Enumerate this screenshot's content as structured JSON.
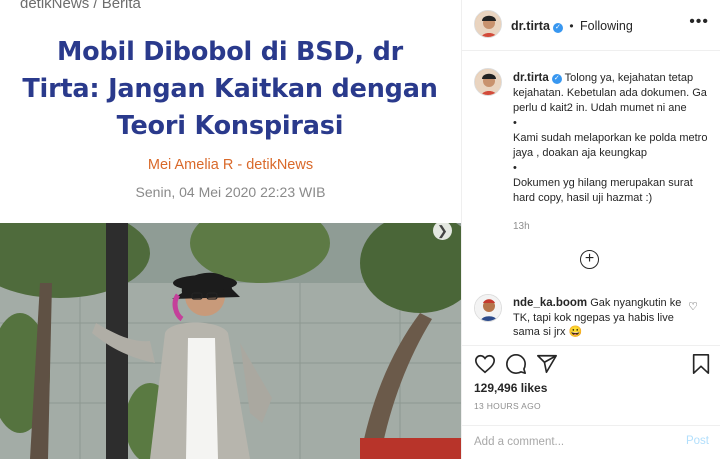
{
  "article": {
    "breadcrumb": "detikNews / Berita",
    "title": "Mobil Dibobol di BSD, dr Tirta: Jangan Kaitkan dengan Teori Konspirasi",
    "byline": "Mei Amelia R - detikNews",
    "date": "Senin, 04 Mei 2020 22:23 WIB"
  },
  "post": {
    "username": "dr.tirta",
    "follow_status": "Following",
    "more_label": "•••"
  },
  "caption": {
    "username": "dr.tirta",
    "lines": [
      "Tolong ya, kejahatan tetap kejahatan. Kebetulan ada dokumen. Ga perlu d kait2 in. Udah mumet ni ane",
      "•",
      "Kami sudah melaporkan ke polda metro jaya , doakan aja keungkap",
      "•",
      "Dokumen yg hilang merupakan surat hard copy, hasil uji hazmat :)"
    ],
    "time": "13h"
  },
  "load_more_label": "+",
  "comment": {
    "username": "nde_ka.boom",
    "text": "Gak nyangkutin ke TK, tapi kok ngepas ya habis live sama si jrx 😀"
  },
  "likes": "129,496 likes",
  "time_ago": "13 HOURS AGO",
  "add_comment": {
    "placeholder": "Add a comment...",
    "post_label": "Post"
  },
  "colors": {
    "title_blue": "#2a3a8c",
    "byline_orange": "#d9692a",
    "verified_blue": "#3897f0",
    "post_button": "#b2dffc"
  },
  "icons": [
    "heart-icon",
    "comment-icon",
    "share-icon",
    "bookmark-icon",
    "verified-icon",
    "chevron-right-icon",
    "plus-circle-icon"
  ]
}
